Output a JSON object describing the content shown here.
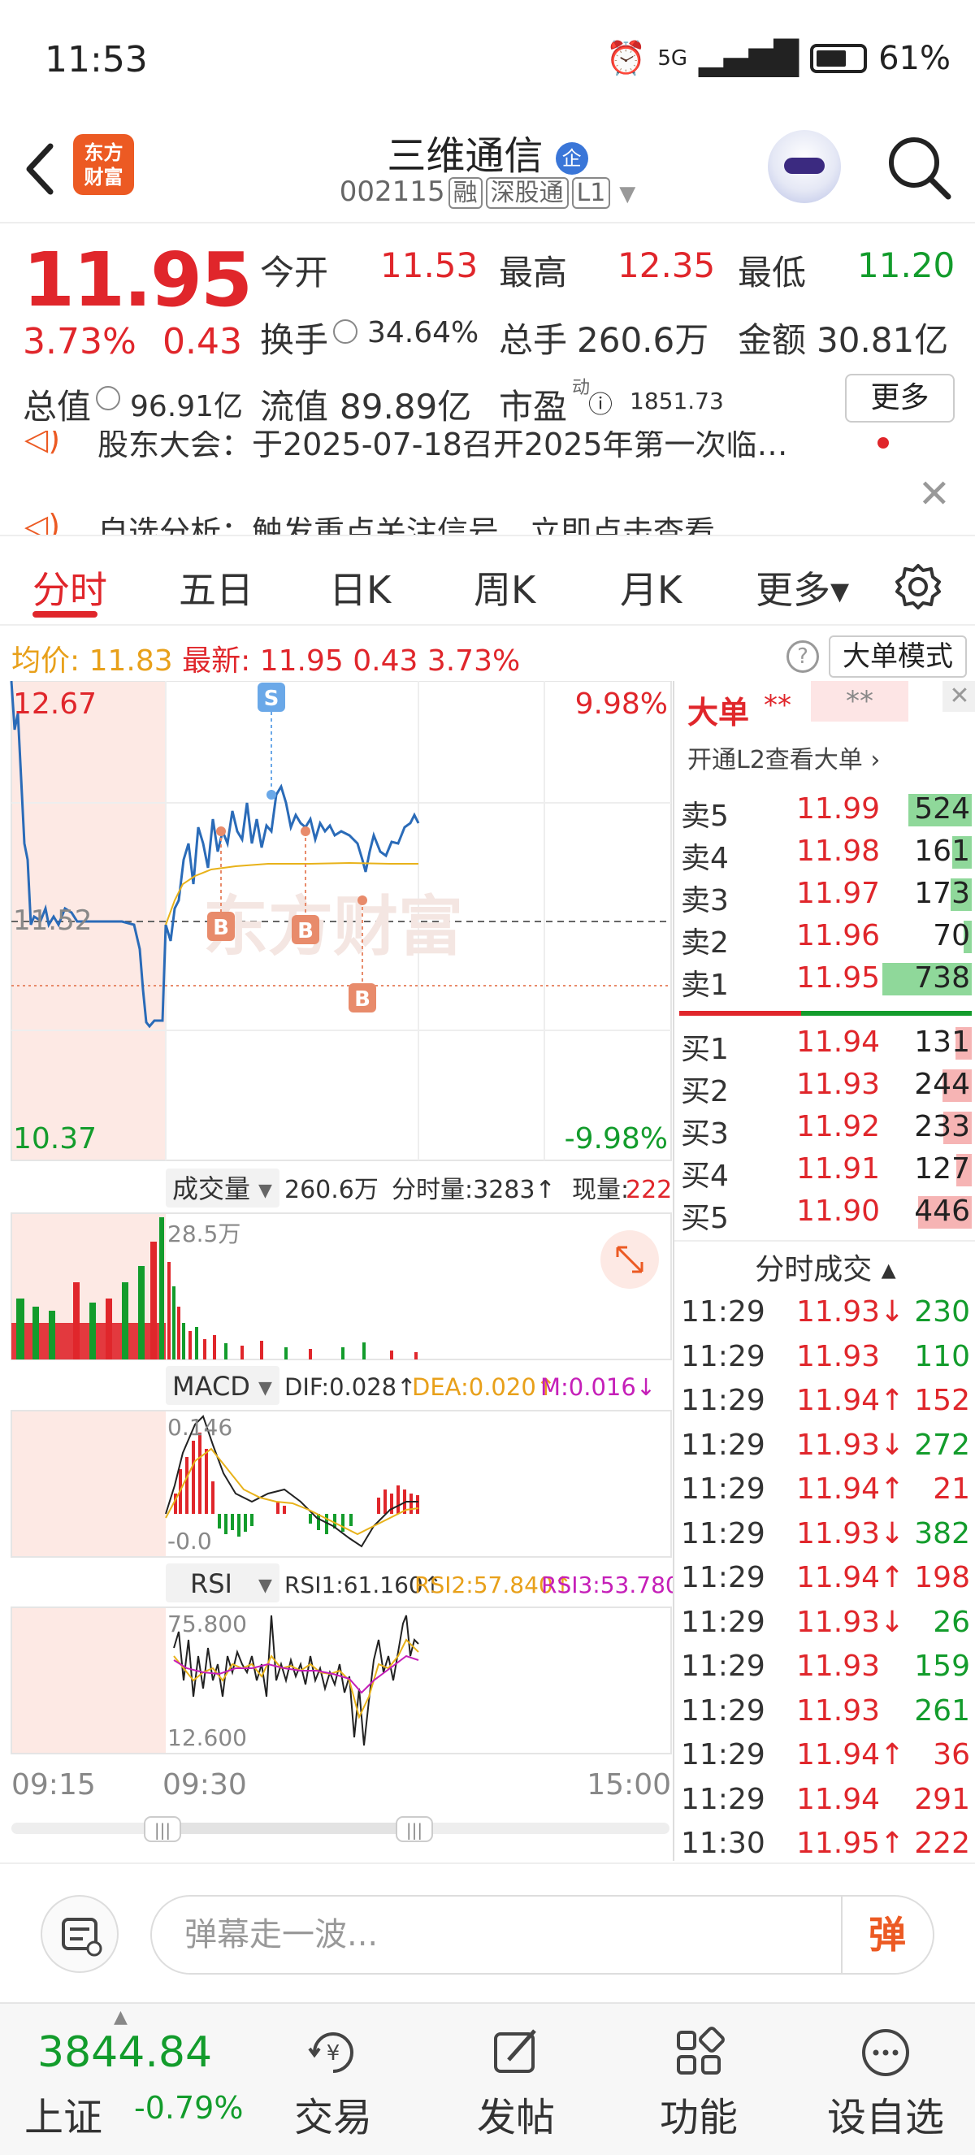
{
  "status": {
    "time": "11:53",
    "network": "5G",
    "battery": "61%"
  },
  "header": {
    "logo": "东方\n财富",
    "name": "三维通信",
    "badge": "企",
    "code": "002115",
    "tags": [
      "融",
      "深股通",
      "L1"
    ]
  },
  "quote": {
    "price": "11.95",
    "pct": "3.73%",
    "change": "0.43",
    "open_label": "今开",
    "open": "11.53",
    "high_label": "最高",
    "high": "12.35",
    "low_label": "最低",
    "low": "11.20",
    "turnover_label": "换手",
    "turnover": "34.64%",
    "volume_label": "总手",
    "volume": "260.6万",
    "amount_label": "金额",
    "amount": "30.81亿",
    "mcap_label": "总值",
    "mcap": "96.91亿",
    "float_label": "流值",
    "float": "89.89亿",
    "pe_label": "市盈",
    "pe_sup": "动",
    "pe": "1851.73",
    "more": "更多"
  },
  "news": {
    "line1": "股东大会：于2025-07-18召开2025年第一次临…",
    "line2": "自选分析：触发重点关注信号，立即点击查看"
  },
  "tabs": [
    "分时",
    "五日",
    "日K",
    "周K",
    "月K",
    "更多▾"
  ],
  "avgline": {
    "avg_label": "均价:",
    "avg": "11.83",
    "latest_label": "最新:",
    "latest": "11.95",
    "chg": "0.43",
    "pct": "3.73%",
    "mode": "大单模式"
  },
  "chart": {
    "price_high": "12.67",
    "price_low": "10.37",
    "pct_high": "9.98%",
    "pct_low": "-9.98%",
    "pre_close": "11.52",
    "vol_label": "成交量",
    "vol_total": "260.6万",
    "vol_split": "分时量:3283↑",
    "vol_now_label": "现量:",
    "vol_now": "222",
    "vol_max": "28.5万",
    "macd_label": "MACD",
    "dif": "DIF:0.028↑",
    "dea": "DEA:0.020↑",
    "m": "M:0.016↓",
    "macd_top": "0.146",
    "macd_bot": "-0.0",
    "rsi_label": "RSI",
    "rsi1": "RSI1:61.160↑",
    "rsi2": "RSI2:57.840↑",
    "rsi3": "RSI3:53.780↑",
    "rsi_top": "75.800",
    "rsi_bot": "12.600",
    "time_start": "09:15",
    "time_open": "09:30",
    "time_end": "15:00",
    "watermark": "东方财富",
    "marker_s": "S",
    "marker_b": "B",
    "colors": {
      "up": "#e0262b",
      "down": "#139c2c",
      "line": "#2a6bb8",
      "avg": "#e8b21a"
    }
  },
  "book": {
    "title": "大单",
    "mask": "**",
    "mask2": "**",
    "l2": "开通L2查看大单 ›",
    "asks": [
      {
        "label": "卖5",
        "price": "11.99",
        "vol": "524"
      },
      {
        "label": "卖4",
        "price": "11.98",
        "vol": "161"
      },
      {
        "label": "卖3",
        "price": "11.97",
        "vol": "173"
      },
      {
        "label": "卖2",
        "price": "11.96",
        "vol": "70"
      },
      {
        "label": "卖1",
        "price": "11.95",
        "vol": "738"
      }
    ],
    "bids": [
      {
        "label": "买1",
        "price": "11.94",
        "vol": "131"
      },
      {
        "label": "买2",
        "price": "11.93",
        "vol": "244"
      },
      {
        "label": "买3",
        "price": "11.92",
        "vol": "233"
      },
      {
        "label": "买4",
        "price": "11.91",
        "vol": "127"
      },
      {
        "label": "买5",
        "price": "11.90",
        "vol": "446"
      }
    ],
    "trades_title": "分时成交 ▴",
    "trades": [
      {
        "t": "11:29",
        "p": "11.93↓",
        "v": "230"
      },
      {
        "t": "11:29",
        "p": "11.93",
        "v": "110"
      },
      {
        "t": "11:29",
        "p": "11.94↑",
        "v": "152"
      },
      {
        "t": "11:29",
        "p": "11.93↓",
        "v": "272"
      },
      {
        "t": "11:29",
        "p": "11.94↑",
        "v": "21"
      },
      {
        "t": "11:29",
        "p": "11.93↓",
        "v": "382"
      },
      {
        "t": "11:29",
        "p": "11.94↑",
        "v": "198"
      },
      {
        "t": "11:29",
        "p": "11.93↓",
        "v": "26"
      },
      {
        "t": "11:29",
        "p": "11.93",
        "v": "159"
      },
      {
        "t": "11:29",
        "p": "11.93",
        "v": "261"
      },
      {
        "t": "11:29",
        "p": "11.94↑",
        "v": "36"
      },
      {
        "t": "11:29",
        "p": "11.94",
        "v": "291"
      },
      {
        "t": "11:30",
        "p": "11.95↑",
        "v": "222"
      }
    ]
  },
  "comment": {
    "placeholder": "弹幕走一波...",
    "danmu": "弹"
  },
  "bottom": {
    "index_val": "3844.84",
    "index_name": "上证",
    "index_pct": "-0.79%",
    "nav": [
      "交易",
      "发帖",
      "功能",
      "设自选"
    ]
  }
}
